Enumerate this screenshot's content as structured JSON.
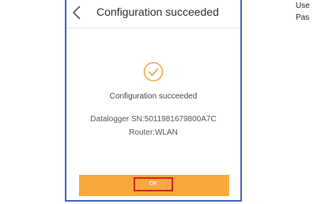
{
  "header": {
    "back_icon": "chevron-left-icon",
    "title": "Configuration succeeded"
  },
  "main": {
    "status_icon": "check-circle-icon",
    "status_text": "Configuration succeeded",
    "datalogger_sn": "Datalogger SN:5011981679800A7C",
    "router": "Router:WLAN"
  },
  "footer": {
    "ok_label": "OK"
  },
  "side_panel": {
    "user_label_fragment": "Use",
    "password_label_fragment": "Pas"
  },
  "colors": {
    "frame_border": "#3f63b5",
    "accent": "#f7a93c",
    "highlight": "#d42020"
  }
}
